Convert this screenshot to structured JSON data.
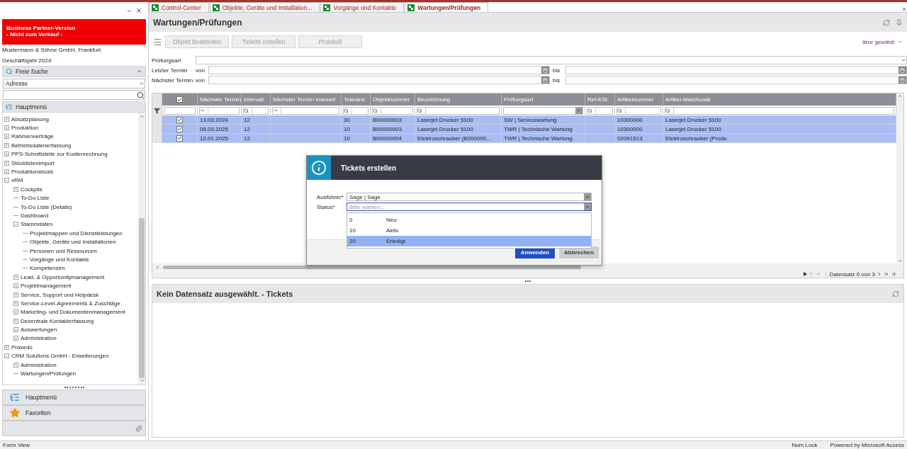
{
  "sidebar": {
    "banner": [
      "Business Partner-Version",
      "- Nicht zum Verkauf -"
    ],
    "company": "Mustermann & Söhne GmbH, Frankfurt",
    "fiscal_year": "Geschäftsjahr 2024",
    "search_panel": {
      "title": "Freie Suche",
      "expanded": true,
      "type": "Adresse"
    },
    "menu_title": "Hauptmenü",
    "tree": [
      {
        "label": "Absatzplanung",
        "kind": "folder",
        "expanded": false
      },
      {
        "label": "Produktion",
        "kind": "folder",
        "expanded": false
      },
      {
        "label": "Rahmenverträge",
        "kind": "folder",
        "expanded": false
      },
      {
        "label": "Betriebsdatenerfassung",
        "kind": "folder",
        "expanded": false
      },
      {
        "label": "PPS-Schnittstelle zur Kostenrechnung",
        "kind": "folder",
        "expanded": false
      },
      {
        "label": "Stücklistenimport",
        "kind": "folder",
        "expanded": false
      },
      {
        "label": "Produktionstools",
        "kind": "folder",
        "expanded": false
      },
      {
        "label": "xRM",
        "kind": "folder",
        "expanded": true,
        "children": [
          {
            "label": "Cockpits",
            "kind": "folder",
            "expanded": false
          },
          {
            "label": "To-Do Liste",
            "kind": "leaf"
          },
          {
            "label": "To-Do Liste (Details)",
            "kind": "leaf"
          },
          {
            "label": "Dashboard",
            "kind": "leaf"
          },
          {
            "label": "Stammdaten",
            "kind": "folder",
            "expanded": true,
            "children": [
              {
                "label": "Projektmappen und Dienstleistungen",
                "kind": "leaf"
              },
              {
                "label": "Objekte, Geräte und Installationen",
                "kind": "leaf"
              },
              {
                "label": "Personen und Ressourcen",
                "kind": "leaf"
              },
              {
                "label": "Vorgänge und Kontakte",
                "kind": "leaf"
              },
              {
                "label": "Kompetenzen",
                "kind": "leaf"
              }
            ]
          },
          {
            "label": "Lead- & Opportunitymanagement",
            "kind": "folder",
            "expanded": false
          },
          {
            "label": "Projektmanagement",
            "kind": "folder",
            "expanded": false
          },
          {
            "label": "Service, Support und Helpdesk",
            "kind": "folder",
            "expanded": false
          },
          {
            "label": "Service-Level-Agreements & Zuschläge",
            "kind": "folder",
            "expanded": false
          },
          {
            "label": "Marketing- und Dokumentenmanagement",
            "kind": "folder",
            "expanded": false
          },
          {
            "label": "Dezentrale Kontakterfassung",
            "kind": "folder",
            "expanded": false
          },
          {
            "label": "Auswertungen",
            "kind": "folder",
            "expanded": false
          },
          {
            "label": "Administration",
            "kind": "folder",
            "expanded": false
          }
        ]
      },
      {
        "label": "Praxedo",
        "kind": "folder",
        "expanded": false
      },
      {
        "label": "CRM Solutions GmbH - Erweiterungen",
        "kind": "folder",
        "expanded": true,
        "children": [
          {
            "label": "Administration",
            "kind": "folder",
            "expanded": false
          },
          {
            "label": "Wartungen/Prüfungen",
            "kind": "leaf"
          }
        ]
      }
    ],
    "nav": [
      "Hauptmenü",
      "Favoriten"
    ]
  },
  "tabs": [
    {
      "label": "Control-Center",
      "selected": false
    },
    {
      "label": "Objekte, Geräte und Installation...",
      "selected": false
    },
    {
      "label": "Vorgänge und Kontakte",
      "selected": false
    },
    {
      "label": "Wartungen/Prüfungen",
      "selected": true
    }
  ],
  "page_title": "Wartungen/Prüfungen",
  "toolbar": {
    "buttons": [
      {
        "label": "Objekt Bearbeiten",
        "disabled": true
      },
      {
        "label": "Tickets erstellen",
        "disabled": true
      },
      {
        "label": "Protokoll",
        "disabled": true
      }
    ],
    "selection": "ätze gewählt"
  },
  "filters": {
    "type_label": "Prüfungsart",
    "ranges": [
      {
        "label": "Letzter Termin",
        "from": "von",
        "to": "bis"
      },
      {
        "label": "Nächster Termin",
        "from": "von",
        "to": "bis"
      }
    ]
  },
  "table": {
    "header_checked": true,
    "columns": [
      {
        "label": "Nächster Termin",
        "kind": "equals"
      },
      {
        "label": "Intervall",
        "kind": "like"
      },
      {
        "label": "Nächster Termin manuell",
        "kind": "equals"
      },
      {
        "label": "Toleranz",
        "kind": "like"
      },
      {
        "label": "Objektnummer",
        "kind": "like"
      },
      {
        "label": "Bezeichnung",
        "kind": "like"
      },
      {
        "label": "Prüfungsart",
        "kind": "list"
      },
      {
        "label": "Ref-KSt.",
        "kind": "like"
      },
      {
        "label": "Artikelnummer",
        "kind": "like"
      },
      {
        "label": "Artikel-Matchcode",
        "kind": "like"
      }
    ],
    "rows": [
      {
        "checked": true,
        "selected": true,
        "cells": [
          "13.03.2024",
          "12",
          "",
          "30",
          "B00000003",
          "Laserjet Drucker 5100",
          "SW  |  Servicewartung",
          "",
          "10300000",
          "Laserjet Drucker 5100"
        ]
      },
      {
        "checked": true,
        "selected": true,
        "cells": [
          "05.03.2025",
          "12",
          "",
          "10",
          "B00000003",
          "Laserjet Drucker 5100",
          "TWR  |  Technische Wartung",
          "",
          "10300000",
          "Laserjet Drucker 5100"
        ]
      },
      {
        "checked": true,
        "selected": true,
        "cells": [
          "12.01.2025",
          "12",
          "",
          "10",
          "B00000004",
          "Elektroschrauber (B000000...",
          "TWR  |  Technische Wartung",
          "",
          "02091513",
          "Elektroschrauber (Produ"
        ]
      }
    ]
  },
  "navigator": "Datensatz 0 von 3",
  "detail_title": "Kein Datensatz ausgewählt. - Tickets",
  "dialog": {
    "title": "Tickets erstellen",
    "fields": [
      {
        "label": "Ausführer*",
        "value": "Sage  |  Sage",
        "focused": false
      },
      {
        "label": "Status*",
        "placeholder": "Bitte wählen...",
        "focused": true
      }
    ],
    "options": [
      {
        "code": "0",
        "label": "Neu",
        "selected": false
      },
      {
        "code": "10",
        "label": "Aktiv",
        "selected": false
      },
      {
        "code": "20",
        "label": "Erledigt",
        "selected": true
      }
    ],
    "buttons": [
      {
        "label": "Anwenden",
        "kind": "primary"
      },
      {
        "label": "Abbrechen",
        "kind": "secondary"
      }
    ]
  },
  "status_bar": {
    "left": "Form View",
    "items": [
      "Num Lock",
      "Powered by Microsoft Access"
    ]
  }
}
